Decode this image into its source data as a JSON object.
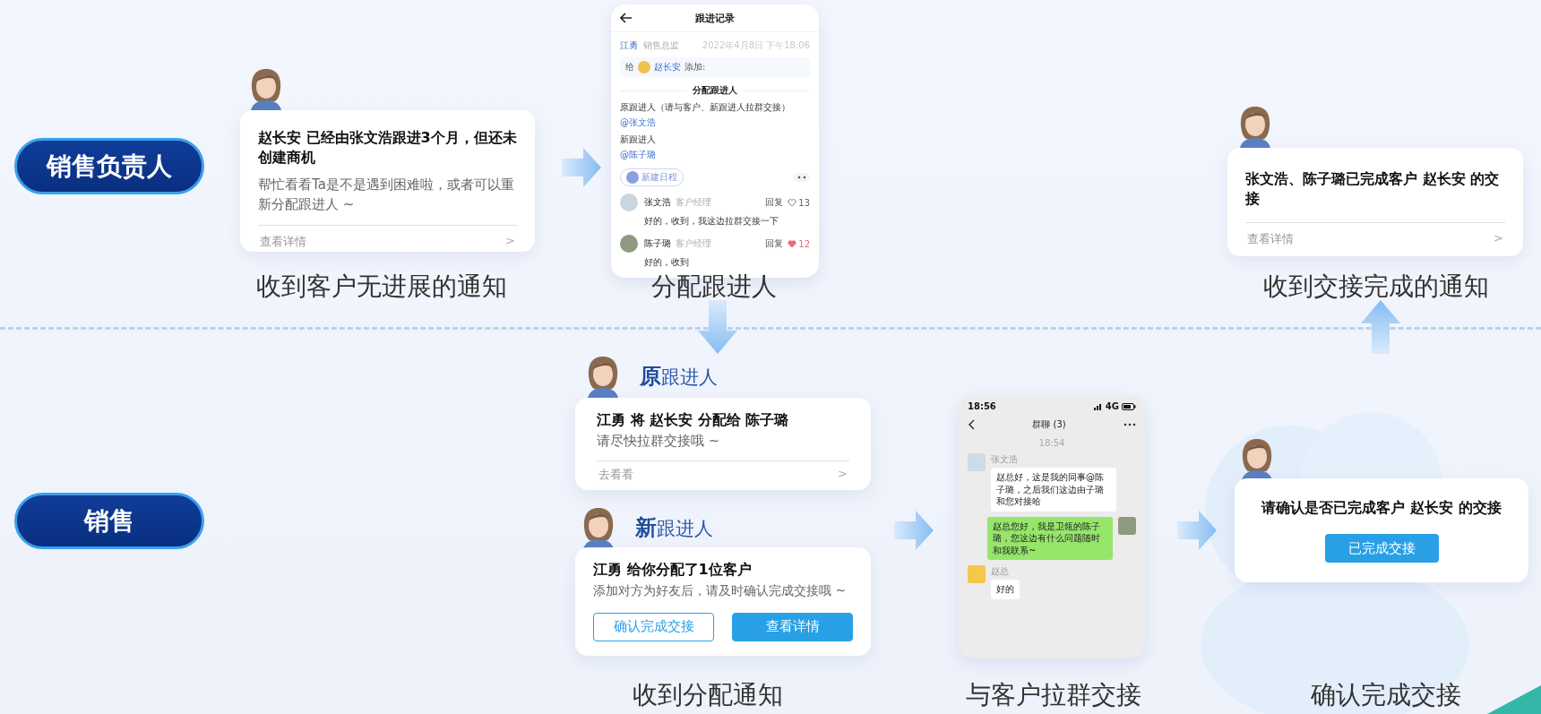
{
  "roles": [
    {
      "label": "销售负责人"
    },
    {
      "label": "销售"
    }
  ],
  "stall_notice": {
    "title": "赵长安 已经由张文浩跟进3个月，但还未创建商机",
    "body": "帮忙看看Ta是不是遇到困难啦，或者可以重新分配跟进人 ~",
    "link": "查看详情",
    "link_arrow": ">",
    "caption": "收到客户无进展的通知"
  },
  "follow_record": {
    "title": "跟进记录",
    "author": "江勇",
    "author_role": "销售总监",
    "time": "2022年4月8日 下午18:06",
    "to_prefix": "给",
    "customer": "赵长安",
    "to_suffix": "添加:",
    "section": "分配跟进人",
    "fields": [
      {
        "label": "原跟进人（请与客户、新跟进人拉群交接）",
        "value": "@张文浩"
      },
      {
        "label": "新跟进人",
        "value": "@陈子璐"
      }
    ],
    "schedule_button": "新建日程",
    "comments": [
      {
        "name": "张文浩",
        "role": "客户经理",
        "reply": "回复",
        "likes": "13",
        "liked": false,
        "text": "好的，收到，我这边拉群交接一下"
      },
      {
        "name": "陈子璐",
        "role": "客户经理",
        "reply": "回复",
        "likes": "12",
        "liked": true,
        "text": "好的，收到"
      }
    ],
    "caption": "分配跟进人"
  },
  "done_notice": {
    "title": "张文浩、陈子璐已完成客户 赵长安 的交接",
    "link": "查看详情",
    "link_arrow": ">",
    "caption": "收到交接完成的通知"
  },
  "original_follower": {
    "prefix": "原",
    "label": "跟进人",
    "title": "江勇 将 赵长安 分配给 陈子璐",
    "body": "请尽快拉群交接哦 ~",
    "link": "去看看",
    "link_arrow": ">"
  },
  "new_follower": {
    "prefix": "新",
    "label": "跟进人",
    "title": "江勇 给你分配了1位客户",
    "body": "添加对方为好友后，请及时确认完成交接哦 ~",
    "buttons": [
      {
        "label": "确认完成交接",
        "kind": "outline"
      },
      {
        "label": "查看详情",
        "kind": "primary"
      }
    ],
    "caption": "收到分配通知"
  },
  "group_chat": {
    "clock": "18:56",
    "network": "4G",
    "title": "群聊 (3)",
    "timestamp": "18:54",
    "messages": [
      {
        "sender": "张文浩",
        "kind": "received",
        "text": "赵总好，这是我的同事@陈子璐，之后我们这边由子璐和您对接哈"
      },
      {
        "kind": "sent",
        "text": "赵总您好，我是卫瓴的陈子璐，您这边有什么问题随时和我联系~"
      },
      {
        "sender": "赵总",
        "kind": "received",
        "text": "好的"
      }
    ],
    "caption": "与客户拉群交接"
  },
  "confirm_notice": {
    "title": "请确认是否已完成客户 赵长安 的交接",
    "button": "已完成交接",
    "caption": "确认完成交接"
  }
}
